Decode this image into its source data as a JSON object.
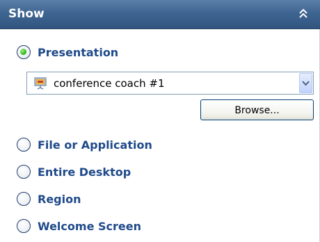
{
  "header": {
    "title": "Show",
    "collapse_icon": "double-chevron-up-icon"
  },
  "options": {
    "presentation": {
      "label": "Presentation",
      "selected": true
    },
    "file_or_application": {
      "label": "File or Application",
      "selected": false
    },
    "entire_desktop": {
      "label": "Entire Desktop",
      "selected": false
    },
    "region": {
      "label": "Region",
      "selected": false
    },
    "welcome_screen": {
      "label": "Welcome Screen",
      "selected": false
    }
  },
  "presentation_select": {
    "value": "conference coach #1",
    "icon": "presentation-icon"
  },
  "browse_button": {
    "label": "Browse..."
  },
  "colors": {
    "header_background": "#3e6591",
    "label_text": "#1f4a8a",
    "radio_selected": "#36c01c"
  }
}
